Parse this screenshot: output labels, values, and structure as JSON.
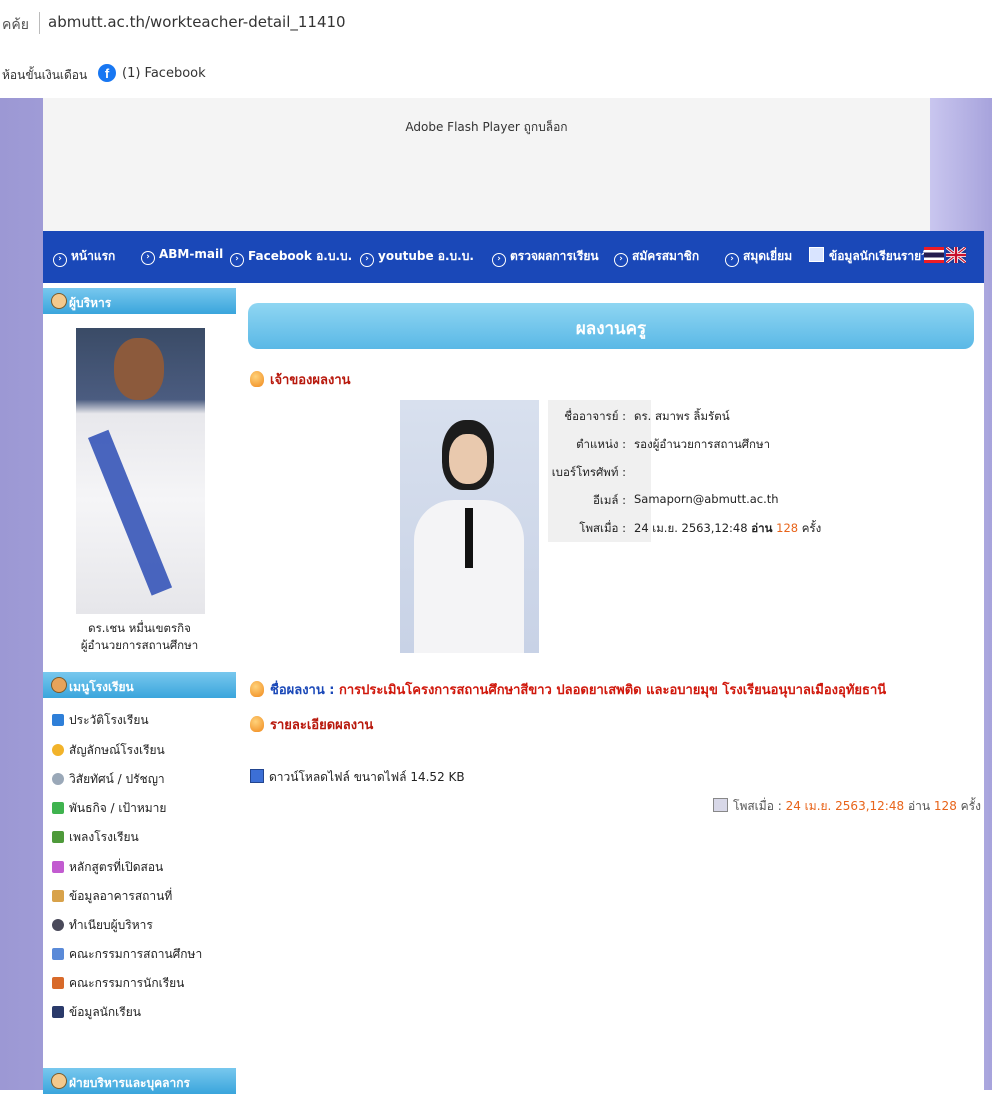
{
  "browser": {
    "url_prefix": "คค้ย",
    "url": "abmutt.ac.th/workteacher-detail_11410",
    "bookmarks": [
      "ห้อนขั้นเงินเดือน",
      "(1) Facebook"
    ]
  },
  "flash_notice": "Adobe Flash Player ถูกบล็อก",
  "nav": {
    "items": [
      "หน้าแรก",
      "ABM-mail",
      "Facebook อ.บ.บ.",
      "youtube อ.บ.บ.",
      "ตรวจผลการเรียน",
      "สมัครสมาชิก",
      "สมุดเยี่ยม",
      "ข้อมูลนักเรียนรายวัน"
    ]
  },
  "sidebar": {
    "admin_header": "ผู้บริหาร",
    "director_name": "ดร.เชน หมื่นเขตรกิจ",
    "director_title": "ผู้อำนวยการสถานศึกษา",
    "menu_header": "เมนูโรงเรียน",
    "menu_items": [
      "ประวัติโรงเรียน",
      "สัญลักษณ์โรงเรียน",
      "วิสัยทัศน์ / ปรัชญา",
      "พันธกิจ / เป้าหมาย",
      "เพลงโรงเรียน",
      "หลักสูตรที่เปิดสอน",
      "ข้อมูลอาคารสถานที่",
      "ทำเนียบผู้บริหาร",
      "คณะกรรมการสถานศึกษา",
      "คณะกรรมการนักเรียน",
      "ข้อมูลนักเรียน"
    ],
    "staff_header": "ฝ่ายบริหารและบุคลากร"
  },
  "main": {
    "page_title": "ผลงานครู",
    "owner_header": "เจ้าของผลงาน",
    "info": {
      "name_label": "ชื่ออาจารย์ :",
      "name": "ดร. สมาพร ลิ้มรัตน์",
      "position_label": "ตำแหน่ง :",
      "position": "รองผู้อำนวยการสถานศึกษา",
      "phone_label": "เบอร์โทรศัพท์ :",
      "phone": "",
      "email_label": "อีเมล์ :",
      "email": "Samaporn@abmutt.ac.th",
      "posted_label": "โพสเมื่อ :",
      "posted": "24 เม.ย. 2563,12:48",
      "read_label": "อ่าน",
      "read_count": "128",
      "times_label": "ครั้ง"
    },
    "work_name_label": "ชื่อผลงาน :",
    "work_name": "การประเมินโครงการสถานศึกษาสีขาว ปลอดยาเสพติด และอบายมุข โรงเรียนอนุบาลเมืองอุทัยธานี",
    "detail_header": "รายละเอียดผลงาน",
    "download": {
      "label": "ดาวน์โหลดไฟล์",
      "size_label": "ขนาดไฟล์",
      "size": "14.52 KB"
    },
    "footer_post": {
      "posted_label": "โพสเมื่อ :",
      "posted": "24 เม.ย. 2563,12:48",
      "read_label": "อ่าน",
      "read_count": "128",
      "times_label": "ครั้ง"
    }
  },
  "colors": {
    "nav_bg": "#1a48b8",
    "title_bar": "#5ab8e6",
    "accent_red": "#b8180c",
    "accent_orange": "#e8641a"
  }
}
